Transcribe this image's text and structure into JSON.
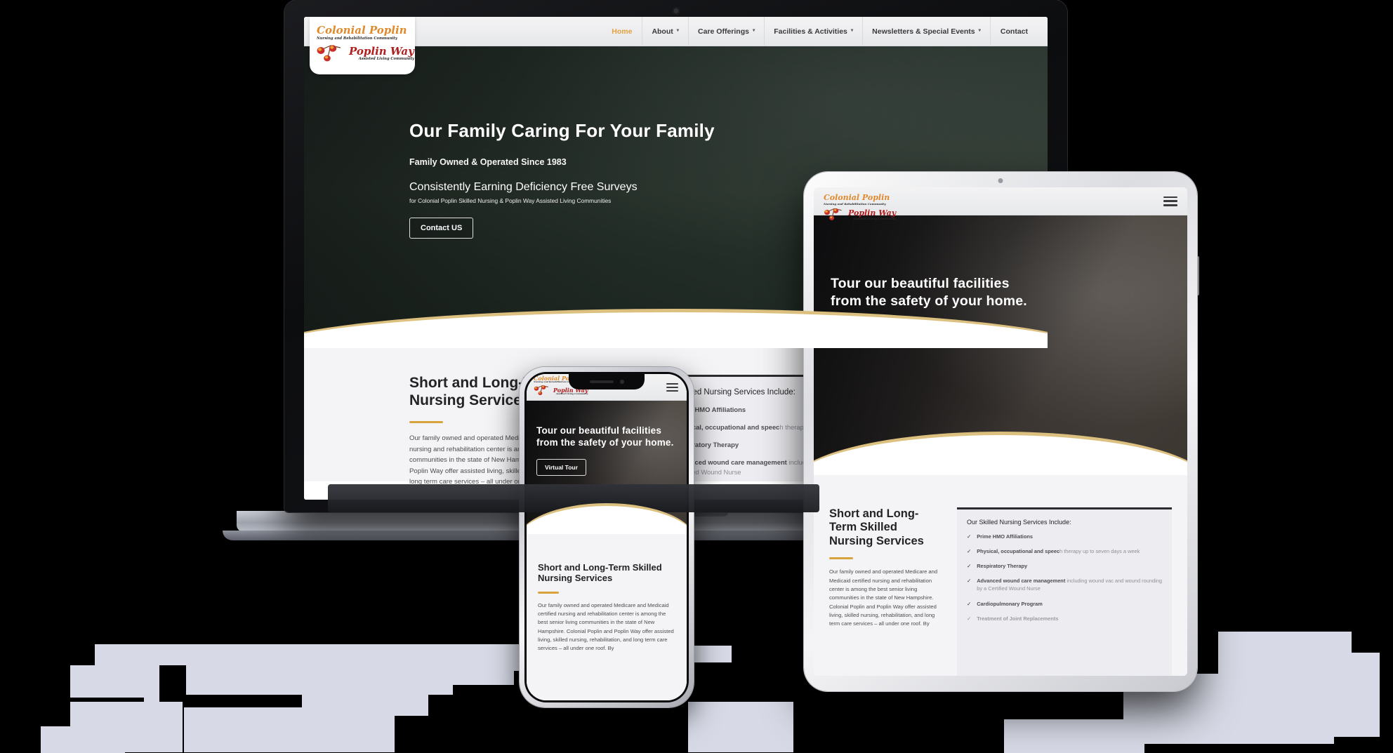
{
  "site": {
    "brand": {
      "line1": "Colonial Poplin",
      "line2": "Nursing and Rehabilitation Community",
      "line3": "Poplin Way",
      "line4": "Assisted Living Community"
    },
    "nav": [
      {
        "label": "Home",
        "caret": "",
        "active": true
      },
      {
        "label": "About",
        "caret": "▾",
        "active": false
      },
      {
        "label": "Care Offerings",
        "caret": "▾",
        "active": false
      },
      {
        "label": "Facilities & Activities",
        "caret": "▾",
        "active": false
      },
      {
        "label": "Newsletters & Special Events",
        "caret": "▾",
        "active": false
      },
      {
        "label": "Contact",
        "caret": "",
        "active": false
      }
    ],
    "hero_desktop": {
      "title": "Our Family Caring For Your Family",
      "subtitle": "Family Owned & Operated Since 1983",
      "line": "Consistently Earning Deficiency Free Surveys",
      "small": "for Colonial Poplin Skilled Nursing & Poplin Way Assisted Living Communities",
      "cta": "Contact US"
    },
    "hero_mobile": {
      "title": "Tour our beautiful facilities from the safety of your home.",
      "cta": "Virtual Tour"
    },
    "section": {
      "title": "Short and Long-Term Skilled Nursing Services",
      "body": "Our family owned and operated Medicare and Medicaid certified nursing and rehabilitation center is among the best senior living communities in the state of New Hampshire. Colonial Poplin and Poplin Way offer assisted living, skilled nursing, rehabilitation, and long term care services – all under one roof. By",
      "panel_heading_bold": "Our Skilled Nursing Service",
      "panel_heading_rest": "s Include:",
      "items": [
        {
          "bold": "Prime HMO Affiliations",
          "rest": ""
        },
        {
          "bold": "Physical, occupational and speec",
          "rest": "h therapy up to seven days a week"
        },
        {
          "bold": "Respiratory Therapy",
          "rest": ""
        },
        {
          "bold": "Advanced wound care management",
          "rest": " including wound vac and wound rounding by a Certified Wound Nurse"
        },
        {
          "bold": "Cardiopulmonary Program",
          "rest": ""
        },
        {
          "bold": "Treatment of Joint Replacements",
          "rest": ""
        }
      ]
    },
    "icons": {
      "hamburger": "hamburger-icon",
      "scroll_down": "chevron-down-icon",
      "check": "✓"
    },
    "colors": {
      "accent_gold": "#d8a33c",
      "brand_orange": "#e08a2e",
      "brand_red": "#b01e1e",
      "curve_gold": "#dcc07f",
      "background": "#000000"
    }
  }
}
